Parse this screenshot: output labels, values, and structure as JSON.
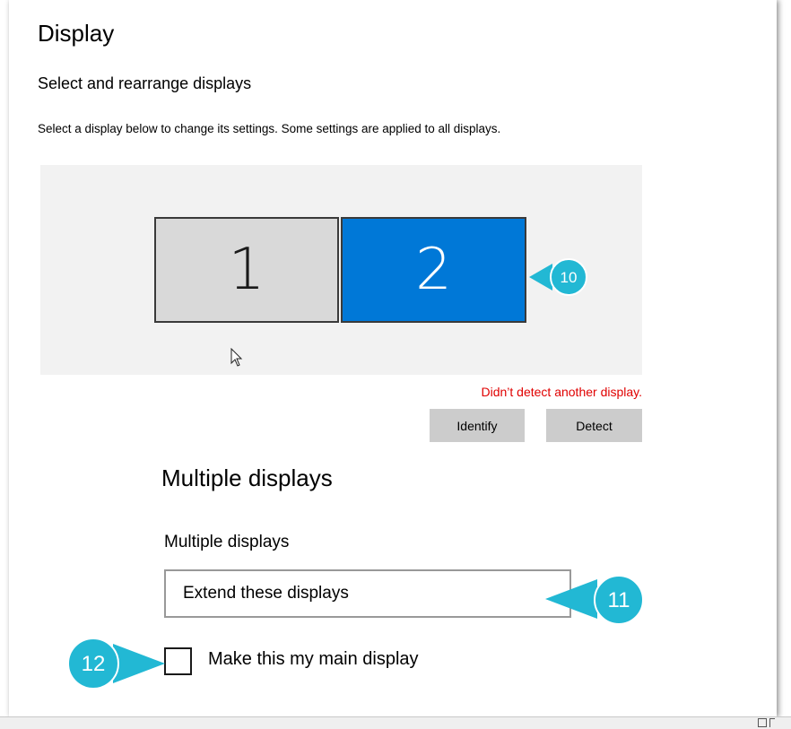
{
  "title": "Display",
  "subtitle": "Select and rearrange displays",
  "description": "Select a display below to change its settings. Some settings are applied to all displays.",
  "monitors": [
    {
      "label": "1",
      "selected": false
    },
    {
      "label": "2",
      "selected": true
    }
  ],
  "warning": "Didn’t detect another display.",
  "buttons": {
    "identify": "Identify",
    "detect": "Detect"
  },
  "multiple_displays": {
    "section_title": "Multiple displays",
    "dropdown_label": "Multiple displays",
    "dropdown_value": "Extend these displays"
  },
  "main_display_checkbox": {
    "label": "Make this my main display",
    "checked": false
  },
  "callouts": [
    "10",
    "11",
    "12"
  ],
  "colors": {
    "accent": "#0078d7",
    "callout": "#22b8d4",
    "warning": "#e00000",
    "button": "#cccccc"
  }
}
